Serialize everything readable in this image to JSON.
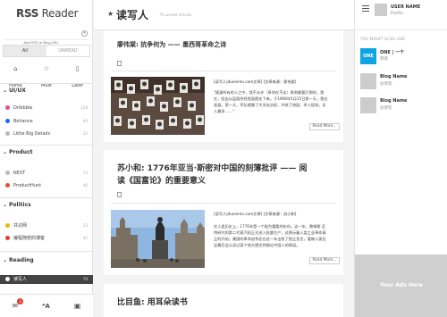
{
  "sidebar": {
    "logo_bold": "RSS",
    "logo_thin": " Reader",
    "add_url_placeholder": "Add RSS or Blog URL",
    "tabs": [
      "All",
      "UNREAD"
    ],
    "quick": [
      {
        "label": "Home",
        "icon": "home-icon",
        "glyph": "⌂"
      },
      {
        "label": "Must",
        "icon": "star-icon",
        "glyph": "☆"
      },
      {
        "label": "Later",
        "icon": "bookmark-icon",
        "glyph": "▯"
      }
    ],
    "sections": [
      {
        "title": "UI/UX",
        "feeds": [
          {
            "name": "Dribbble",
            "count": "128",
            "color": "#ea4c89"
          },
          {
            "name": "Behance",
            "count": "40",
            "color": "#1769ff"
          },
          {
            "name": "Little Big Details",
            "count": "32",
            "color": "#b9b9b9"
          }
        ]
      },
      {
        "title": "Product",
        "feeds": [
          {
            "name": "NEXT",
            "count": "73",
            "color": "#bbbbbb"
          },
          {
            "name": "ProductHunt",
            "count": "46",
            "color": "#da552f"
          }
        ]
      },
      {
        "title": "Politics",
        "feeds": [
          {
            "name": "共识网",
            "count": "23",
            "color": "#f2b400"
          },
          {
            "name": "编程随想的博客",
            "count": "42",
            "color": "#e53935"
          }
        ]
      },
      {
        "title": "Reading",
        "feeds": [
          {
            "name": "读写人",
            "count": "70",
            "color": "#ffffff"
          }
        ]
      }
    ],
    "bottom_badge": "3"
  },
  "main": {
    "title": "读写人",
    "subtitle": "70 unread articles",
    "more_label": "Read More...",
    "articles": [
      {
        "title": "廖伟棠: 抗争何为 —— 墨西哥革命之诗",
        "source": "[读写人|duxieren.com文章] [文章来源：廖伟棠]",
        "body": "\"随意所有的人之中，我不允许（革命在不去）原则最要打倒的，我在，阻出以层面所经首面歷史下来。于1968年5月15日那一天，我在发展，第一天，军队就踏了大学自治权，冲进了校园，杀人捉狱，反人最多……\""
      },
      {
        "title_line1": "苏小和: 1776年亚当·斯密对中国的刻薄批评 —— 阅",
        "title_line2": "读《国富论》的重要意义",
        "source": "[读写人|duxieren.com文章] [文章来源：苏小和]",
        "body": "在人类历史上，1776年是一个极为重要的年份。这一年，詹姆斯·瓦特研究的第二代蒸汽机正式进入批量生产，这预示着人类工业革命真正的开始；美国的革命战争还在这一年击败了独立宣言，要做人类社会最后会认读过某个地方提交到理论中国人的原因。"
      },
      {
        "title": "比目鱼: 用耳朵读书"
      }
    ]
  },
  "right": {
    "user_name": "USER NAME",
    "user_profile": "Profile",
    "might_like": "YOU MIGHT ALSO LIKE",
    "suggestions": [
      {
        "name": "ONE | 一个",
        "desc": "韩寒",
        "thumb": "ONE"
      },
      {
        "name": "Blog Name",
        "desc": "加博客",
        "thumb": ""
      },
      {
        "name": "Blog Name",
        "desc": "加博客",
        "thumb": ""
      }
    ],
    "ads_label": "Your Ads Here"
  }
}
